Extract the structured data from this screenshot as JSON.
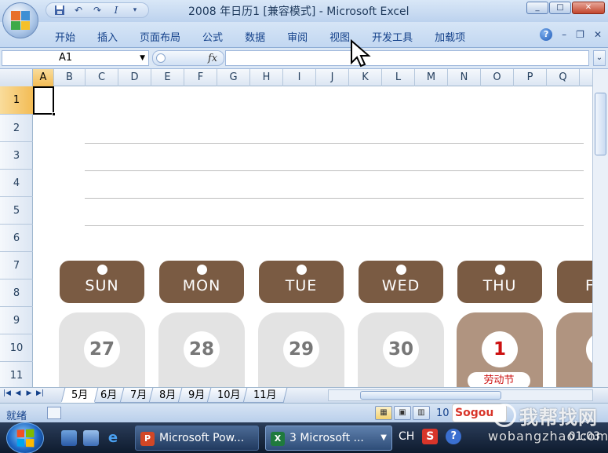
{
  "window": {
    "title": "2008 年日历1  [兼容模式] - Microsoft Excel",
    "minimize": "_",
    "maximize": "□",
    "close": "✕"
  },
  "quick_access": {
    "save_icon": "save-icon",
    "undo_icon": "undo-icon",
    "redo_icon": "redo-icon",
    "customize_icon": "dropdown-icon"
  },
  "ribbon": {
    "tabs": [
      "开始",
      "插入",
      "页面布局",
      "公式",
      "数据",
      "审阅",
      "视图",
      "开发工具",
      "加载项"
    ],
    "help": "?",
    "minimize": "–",
    "restore": "❐",
    "close": "✕"
  },
  "formula_bar": {
    "name_box": "A1",
    "fx": "fx",
    "formula": ""
  },
  "columns": [
    "A",
    "B",
    "C",
    "D",
    "E",
    "F",
    "G",
    "H",
    "I",
    "J",
    "K",
    "L",
    "M",
    "N",
    "O",
    "P",
    "Q"
  ],
  "rows": [
    "1",
    "2",
    "3",
    "4",
    "5",
    "6",
    "7",
    "8",
    "9",
    "10",
    "11"
  ],
  "calendar": {
    "days": [
      "SUN",
      "MON",
      "TUE",
      "WED",
      "THU",
      "F"
    ],
    "dates": [
      "27",
      "28",
      "29",
      "30",
      "1",
      ""
    ],
    "holiday_label": "劳动节"
  },
  "sheets": [
    "5月",
    "6月",
    "7月",
    "8月",
    "9月",
    "10月",
    "11月"
  ],
  "active_sheet": "5月",
  "status": {
    "ready": "就绪",
    "zoom": "10"
  },
  "sogou": "Sogou",
  "taskbar": {
    "tasks": [
      "Microsoft Pow...",
      "3 Microsoft ..."
    ],
    "lang": "CH",
    "sogou_tray": "S",
    "help_tray": "?",
    "clock": "01:03"
  },
  "watermark": {
    "cn": "我帮找网",
    "en": "wobangzhao.com"
  },
  "colors": {
    "ribbon": "#c2d7f1",
    "day_pill": "#7a5b43",
    "date_card": "#e3e3e3",
    "holiday_card": "#b09480",
    "holiday_text": "#cc1111",
    "active_header": "#f3bc55"
  }
}
